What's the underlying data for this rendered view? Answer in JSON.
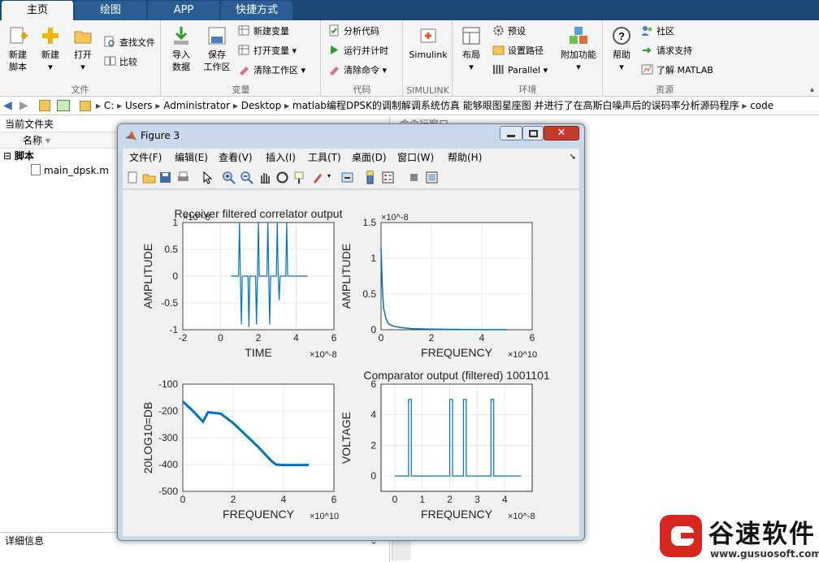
{
  "colors": {
    "tabbar": "#1e4a78",
    "plot_line": "#0072bd",
    "close_red": "#c43b2e",
    "logo_red": "#d7261e"
  },
  "tabs": [
    "主页",
    "绘图",
    "APP",
    "快捷方式"
  ],
  "ribbon": {
    "file": {
      "new_script": "新建\n脚本",
      "new": "新建",
      "open": "打开",
      "find_files": "查找文件",
      "compare": "比较",
      "group": "文件"
    },
    "variable": {
      "import": "导入\n数据",
      "save_ws": "保存\n工作区",
      "new_var": "新建变量",
      "open_var": "打开变量",
      "clear_ws": "清除工作区",
      "group": "变量"
    },
    "code": {
      "analyze": "分析代码",
      "run_time": "运行并计时",
      "clear_cmds": "清除命令",
      "group": "代码"
    },
    "simulink": {
      "label": "Simulink",
      "group": "SIMULINK"
    },
    "env": {
      "layout": "布局",
      "prefs": "预设",
      "set_path": "设置路径",
      "parallel": "Parallel",
      "addons": "附加功能",
      "group": "环境"
    },
    "resources": {
      "help": "帮助",
      "community": "社区",
      "support": "请求支持",
      "learn": "了解 MATLAB",
      "group": "资源"
    }
  },
  "address": {
    "segments": [
      "C:",
      "Users",
      "Administrator",
      "Desktop",
      "matlab编程DPSK的调制解调系统仿真 能够眼图星座图 并进行了在高斯白噪声后的误码率分析源码程序",
      "code"
    ]
  },
  "leftpanel": {
    "title": "当前文件夹",
    "col_name": "名称",
    "group": "脚本",
    "file": "main_dpsk.m",
    "details": "详细信息"
  },
  "cmdwin": {
    "title": "命令行窗口"
  },
  "figure": {
    "title": "Figure 3",
    "menu": [
      "文件(F)",
      "编辑(E)",
      "查看(V)",
      "插入(I)",
      "工具(T)",
      "桌面(D)",
      "窗口(W)",
      "帮助(H)"
    ]
  },
  "chart_data": [
    {
      "type": "line",
      "title": "Receiver filtered correlator output",
      "xlabel": "TIME",
      "ylabel": "AMPLITUDE",
      "x_exponent": "×10^-8",
      "y_exponent": "×10^-8",
      "xlim": [
        -2,
        6
      ],
      "ylim": [
        -1,
        1
      ],
      "xticks": [
        "-2",
        "0",
        "2",
        "4",
        "6"
      ],
      "yticks": [
        "1",
        "0.5",
        "0",
        "-0.5",
        "-1"
      ],
      "grid": true,
      "series": [
        {
          "pulses": [
            {
              "x": 0.55,
              "y": 0.0
            },
            {
              "x": 1.0,
              "y": 1.0
            },
            {
              "x": 1.1,
              "y": -0.9
            },
            {
              "x": 1.5,
              "y": -0.95
            },
            {
              "x": 1.9,
              "y": -0.9
            },
            {
              "x": 2.0,
              "y": 1.0
            },
            {
              "x": 2.5,
              "y": 1.0
            },
            {
              "x": 2.6,
              "y": -0.9
            },
            {
              "x": 3.0,
              "y": 1.0
            },
            {
              "x": 3.1,
              "y": -0.45
            },
            {
              "x": 3.5,
              "y": 1.0
            },
            {
              "x": 4.6,
              "y": 0.0
            }
          ]
        }
      ]
    },
    {
      "type": "line",
      "title": "",
      "xlabel": "FREQUENCY",
      "ylabel": "AMPLITUDE",
      "x_exponent": "×10^10",
      "y_exponent": "×10^-8",
      "xlim": [
        0,
        6
      ],
      "ylim": [
        0,
        1.5
      ],
      "xticks": [
        "0",
        "2",
        "4",
        "6"
      ],
      "yticks": [
        "1.5",
        "1",
        "0.5",
        "0"
      ],
      "grid": true,
      "series": [
        {
          "x": [
            0,
            0.05,
            0.1,
            0.2,
            0.3,
            0.5,
            0.8,
            1.2,
            2,
            3,
            4,
            5
          ],
          "y": [
            1.15,
            0.6,
            0.3,
            0.15,
            0.08,
            0.05,
            0.03,
            0.015,
            0.008,
            0.004,
            0.002,
            0.001
          ]
        }
      ]
    },
    {
      "type": "line",
      "title": "",
      "xlabel": "FREQUENCY",
      "ylabel": "20LOG10=DB",
      "x_exponent": "×10^10",
      "xlim": [
        0,
        6
      ],
      "ylim": [
        -500,
        -100
      ],
      "xticks": [
        "0",
        "2",
        "4",
        "6"
      ],
      "yticks": [
        "-100",
        "-200",
        "-300",
        "-400",
        "-500"
      ],
      "grid": true,
      "series": [
        {
          "x": [
            0,
            0.4,
            0.8,
            1.0,
            1.5,
            2.0,
            2.5,
            3.0,
            3.5,
            3.7,
            4.0,
            5.0
          ],
          "y": [
            -165,
            -200,
            -240,
            -205,
            -210,
            -245,
            -290,
            -335,
            -385,
            -400,
            -402,
            -402
          ]
        }
      ]
    },
    {
      "type": "line",
      "title": "Comparator output (filtered) 1001101",
      "xlabel": "FREQUENCY",
      "ylabel": "VOLTAGE",
      "x_exponent": "×10^-8",
      "xlim": [
        -0.5,
        5
      ],
      "ylim": [
        -1,
        6
      ],
      "xticks": [
        "0",
        "1",
        "2",
        "3",
        "4"
      ],
      "yticks": [
        "6",
        "4",
        "2",
        "0"
      ],
      "grid": true,
      "series": [
        {
          "rects": [
            [
              0.5,
              0.6
            ],
            [
              2.0,
              2.1
            ],
            [
              2.5,
              2.6
            ],
            [
              3.5,
              3.6
            ]
          ],
          "high": 5,
          "low": 0,
          "xend": 4.6
        }
      ]
    }
  ],
  "watermark": {
    "brand": "谷速软件",
    "url": "www.gusuosoft.com"
  }
}
